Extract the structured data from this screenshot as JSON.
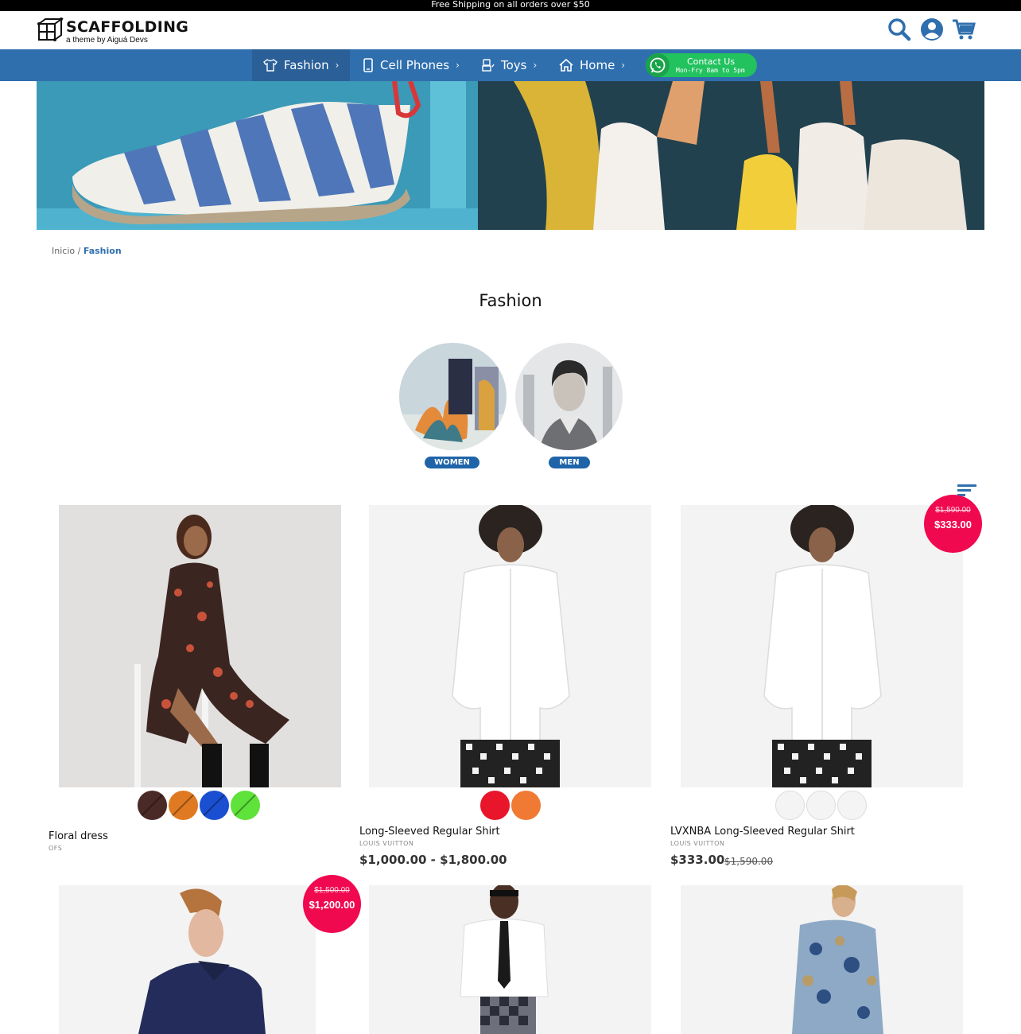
{
  "announcement": "Free Shipping on all orders over $50",
  "brand": {
    "title": "SCAFFOLDING",
    "subtitle": "a theme by Aiguá Devs"
  },
  "header_icons": [
    "search-icon",
    "user-icon",
    "cart-icon"
  ],
  "nav": {
    "items": [
      {
        "label": "Fashion",
        "icon": "tshirt-icon",
        "chevron": "›"
      },
      {
        "label": "Cell Phones",
        "icon": "phone-icon",
        "chevron": "›"
      },
      {
        "label": "Toys",
        "icon": "robot-icon",
        "chevron": "›"
      },
      {
        "label": "Home",
        "icon": "home-icon",
        "chevron": "›"
      }
    ],
    "contact": {
      "title": "Contact Us",
      "hours": "Mon-Fry 8am to 5pm",
      "icon": "whatsapp-icon"
    }
  },
  "breadcrumb": {
    "home": "Inicio",
    "sep": "/",
    "current": "Fashion"
  },
  "page_title": "Fashion",
  "categories": [
    {
      "label": "WOMEN"
    },
    {
      "label": "MEN"
    }
  ],
  "products": [
    {
      "name": "Floral dress",
      "brand": "OFS",
      "price": "",
      "old_price": "",
      "swatch_colors": [
        "#4a2a26",
        "#e07a22",
        "#1a4fd1",
        "#5fe23a"
      ]
    },
    {
      "name": "Long-Sleeved Regular Shirt",
      "brand": "LOUIS VUITTON",
      "price": "$1,000.00 - $1,800.00",
      "old_price": "",
      "swatch_colors": [
        "#e8152b",
        "#f07a34"
      ]
    },
    {
      "name": "LVXNBA Long-Sleeved Regular Shirt",
      "brand": "LOUIS VUITTON",
      "price": "$333.00",
      "old_price": "$1,590.00",
      "swatch_colors": [
        "#f4f4f4",
        "#f4f4f4",
        "#f4f4f4"
      ],
      "badge": {
        "old": "$1,590.00",
        "new": "$333.00"
      }
    },
    {
      "name": "",
      "brand": "",
      "price": "",
      "old_price": "",
      "badge": {
        "old": "$1,500.00",
        "new": "$1,200.00"
      }
    },
    {
      "name": "",
      "brand": "",
      "price": "",
      "old_price": ""
    },
    {
      "name": "",
      "brand": "",
      "price": "",
      "old_price": ""
    }
  ],
  "colors": {
    "nav": "#2f6fae",
    "badge": "#f0094f",
    "whatsapp": "#22c25e",
    "category_label": "#1f64a8"
  }
}
